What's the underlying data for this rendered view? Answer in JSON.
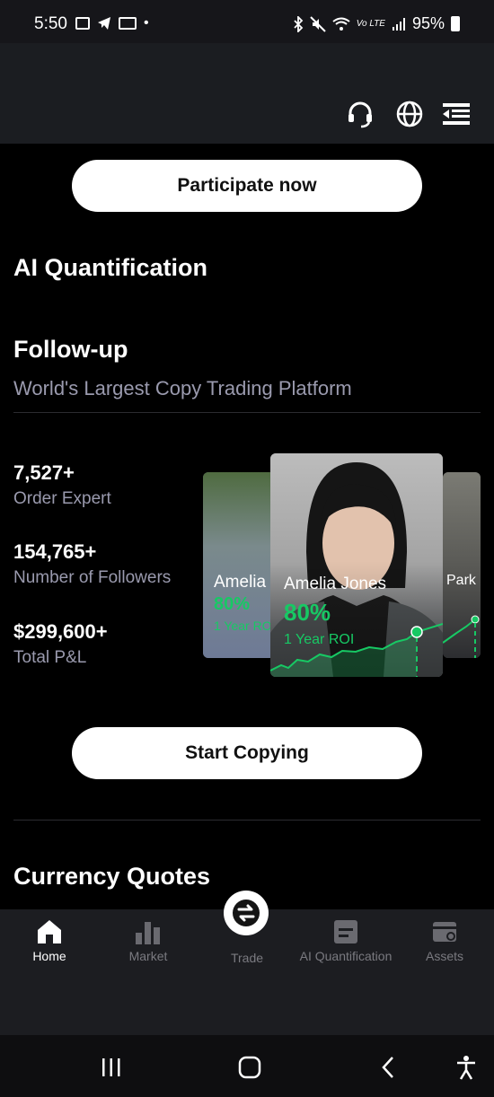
{
  "status_bar": {
    "time": "5:50",
    "dot": "•",
    "battery": "95%",
    "network": "Vo LTE"
  },
  "header": {
    "icons": [
      "headset-icon",
      "globe-icon",
      "menu-icon"
    ]
  },
  "participate_button": "Participate now",
  "ai_title": "AI Quantification",
  "followup": {
    "title": "Follow-up",
    "subtitle": "World's Largest Copy Trading Platform",
    "stats": [
      {
        "value": "7,527+",
        "label": "Order Expert"
      },
      {
        "value": "154,765+",
        "label": "Number of Followers"
      },
      {
        "value": "$299,600+",
        "label": "Total P&L"
      }
    ],
    "cards": {
      "left": {
        "name": "Amelia Jones",
        "pct": "80%",
        "roi": "1 Year ROI"
      },
      "main": {
        "name": "Amelia Jones",
        "pct": "80%",
        "roi": "1 Year ROI"
      },
      "right": {
        "name": "Park"
      }
    }
  },
  "start_copying_button": "Start Copying",
  "currency_title": "Currency Quotes",
  "bottom_nav": [
    {
      "label": "Home",
      "icon": "home-icon",
      "active": true
    },
    {
      "label": "Market",
      "icon": "bar-chart-icon",
      "active": false
    },
    {
      "label": "Trade",
      "icon": "swap-icon",
      "active": false
    },
    {
      "label": "AI Quantification",
      "icon": "document-icon",
      "active": false
    },
    {
      "label": "Assets",
      "icon": "wallet-icon",
      "active": false
    }
  ],
  "colors": {
    "accent_green": "#17c964",
    "muted_text": "#9a9aae",
    "background": "#000000",
    "header_bg": "#1b1d21"
  }
}
